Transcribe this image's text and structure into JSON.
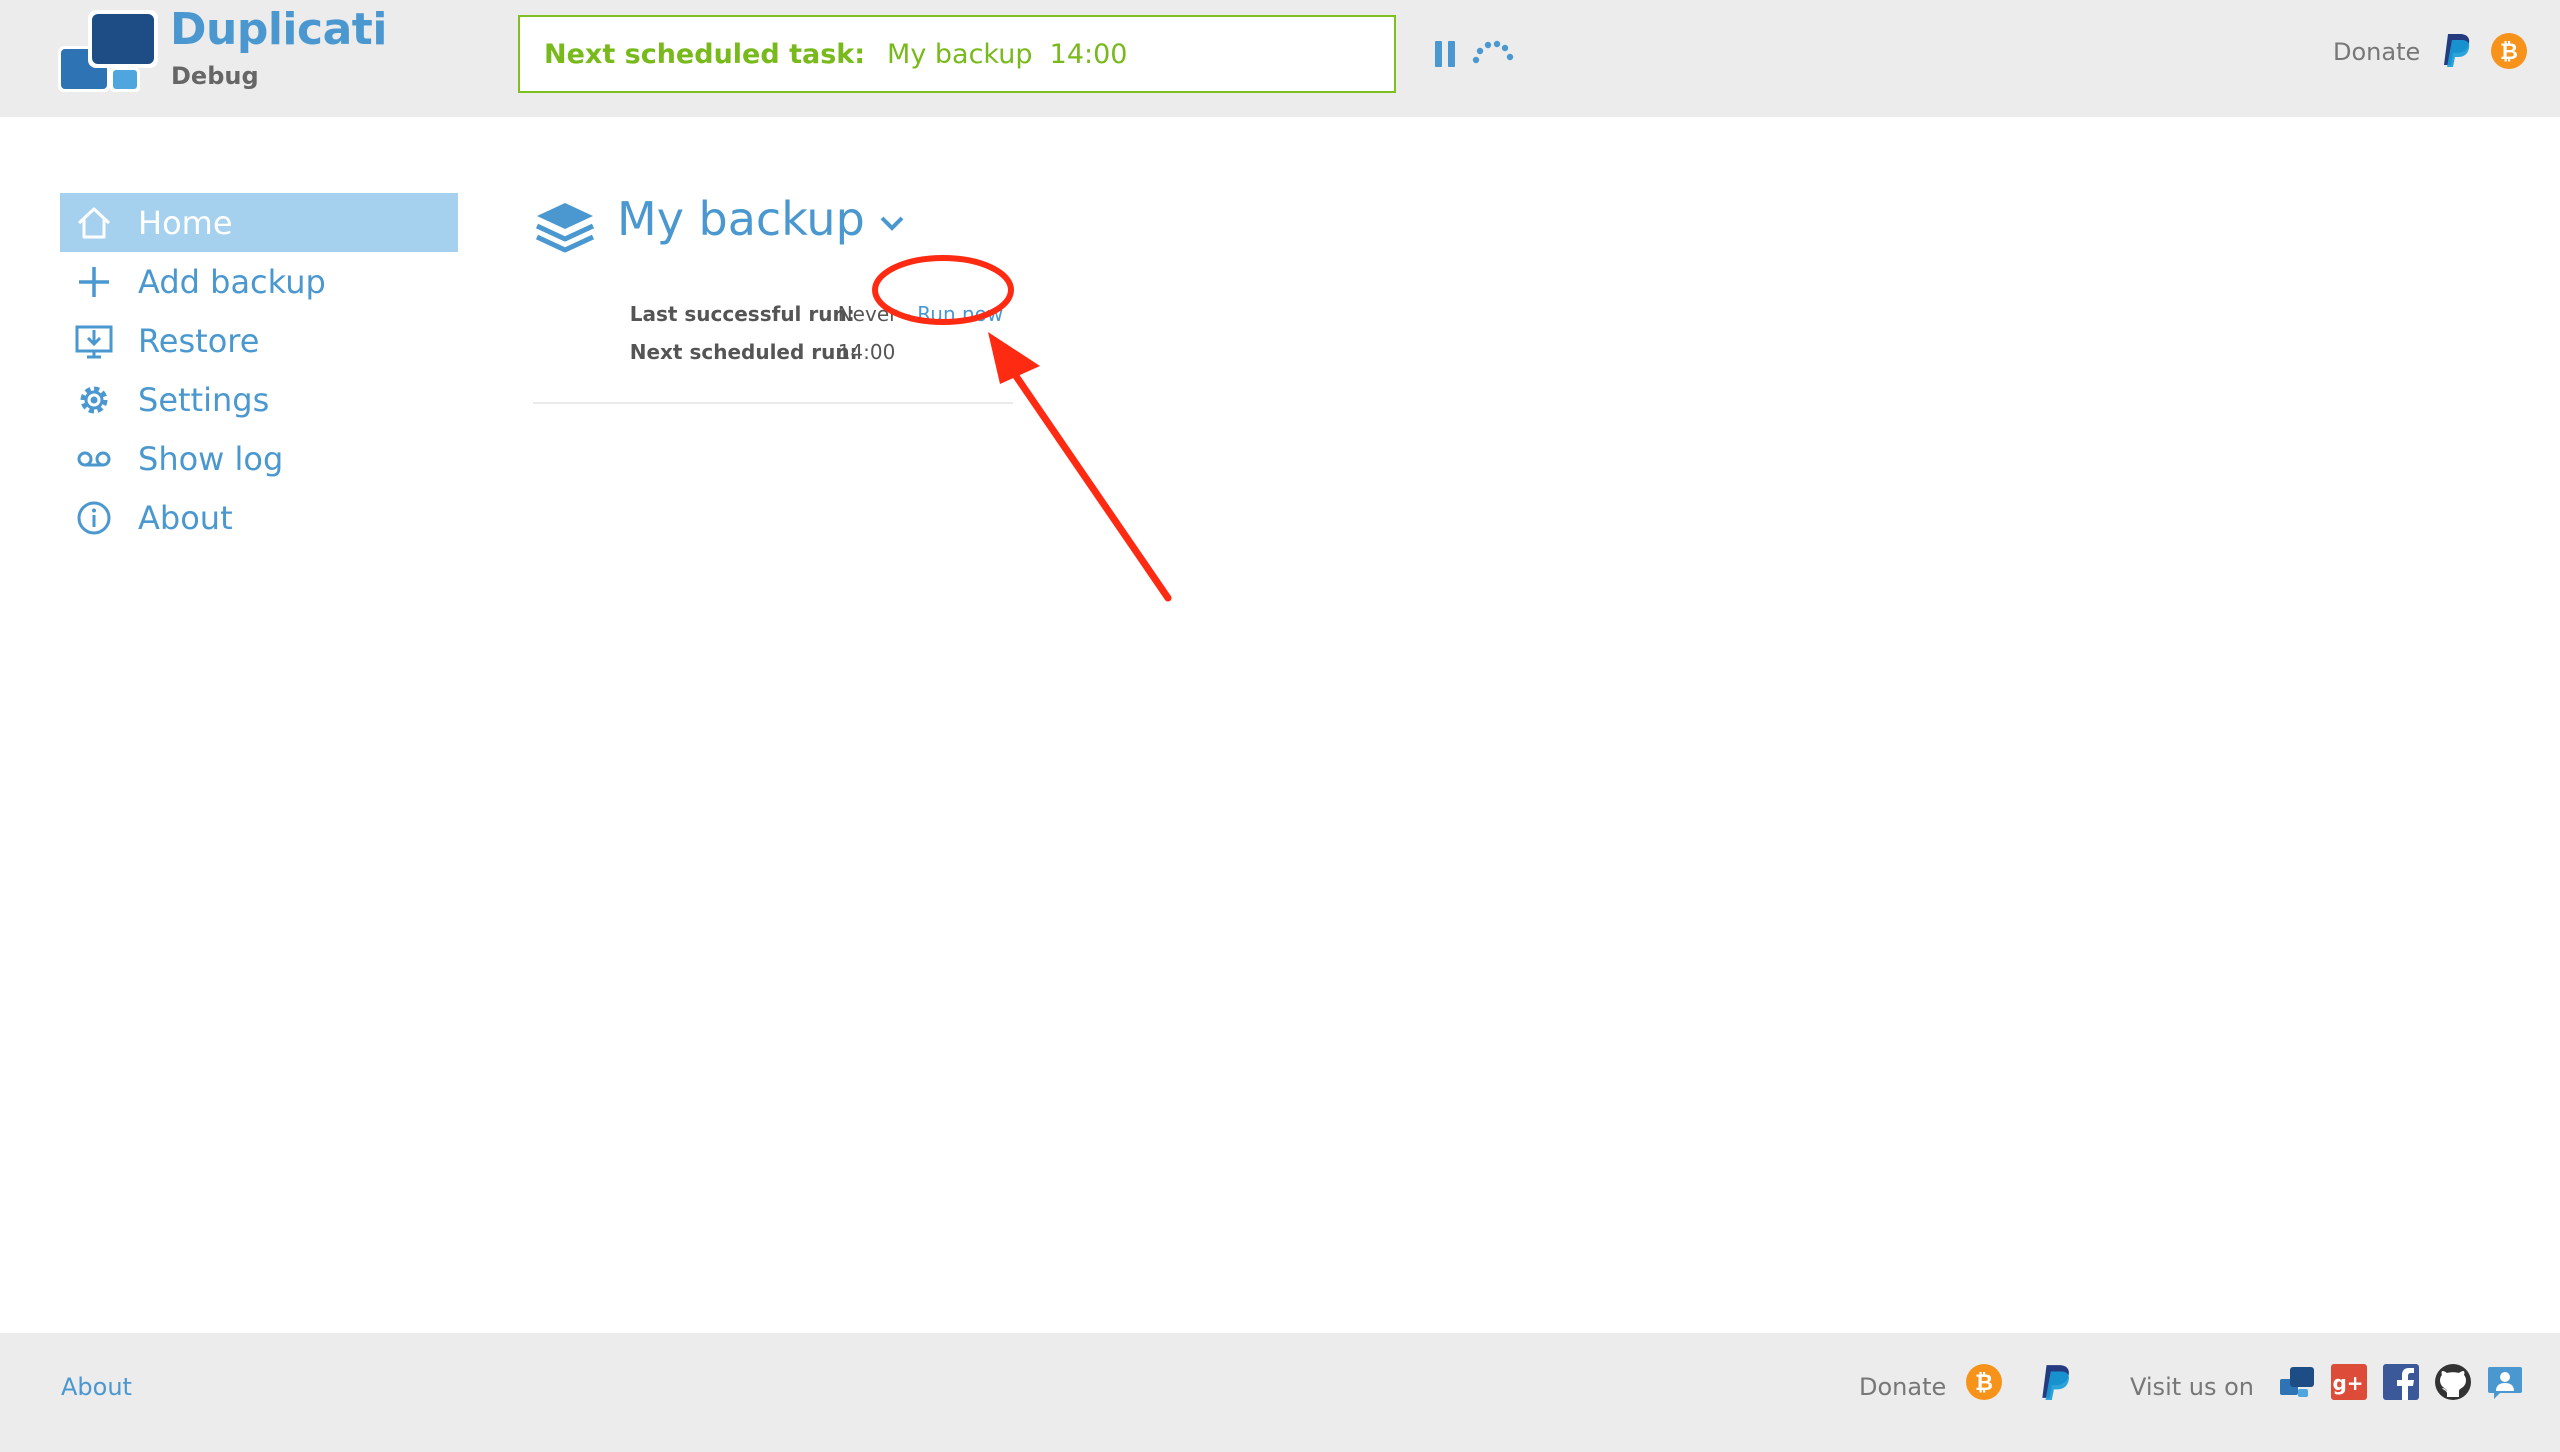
{
  "header": {
    "brand_name": "Duplicati",
    "brand_subtitle": "Debug",
    "task_label": "Next scheduled task:",
    "task_value": "My backup  14:00",
    "donate_label": "Donate"
  },
  "sidebar": {
    "items": [
      {
        "label": "Home",
        "icon": "home-icon",
        "active": true
      },
      {
        "label": "Add backup",
        "icon": "plus-icon",
        "active": false
      },
      {
        "label": "Restore",
        "icon": "restore-icon",
        "active": false
      },
      {
        "label": "Settings",
        "icon": "gear-icon",
        "active": false
      },
      {
        "label": "Show log",
        "icon": "log-icon",
        "active": false
      },
      {
        "label": "About",
        "icon": "info-icon",
        "active": false
      }
    ]
  },
  "main": {
    "backup_title": "My backup",
    "last_run_label": "Last successful run:",
    "last_run_value": "Never",
    "separator": "-",
    "run_now_label": "Run now",
    "next_run_label": "Next scheduled run:",
    "next_run_value": "14:00"
  },
  "footer": {
    "about_label": "About",
    "donate_label": "Donate",
    "visit_label": "Visit us on"
  },
  "colors": {
    "accent": "#4a98cf",
    "active_nav_bg": "#a5d1ee",
    "task_green": "#78b91c",
    "annotation_red": "#ff2a12",
    "bar_bg": "#ececec"
  }
}
